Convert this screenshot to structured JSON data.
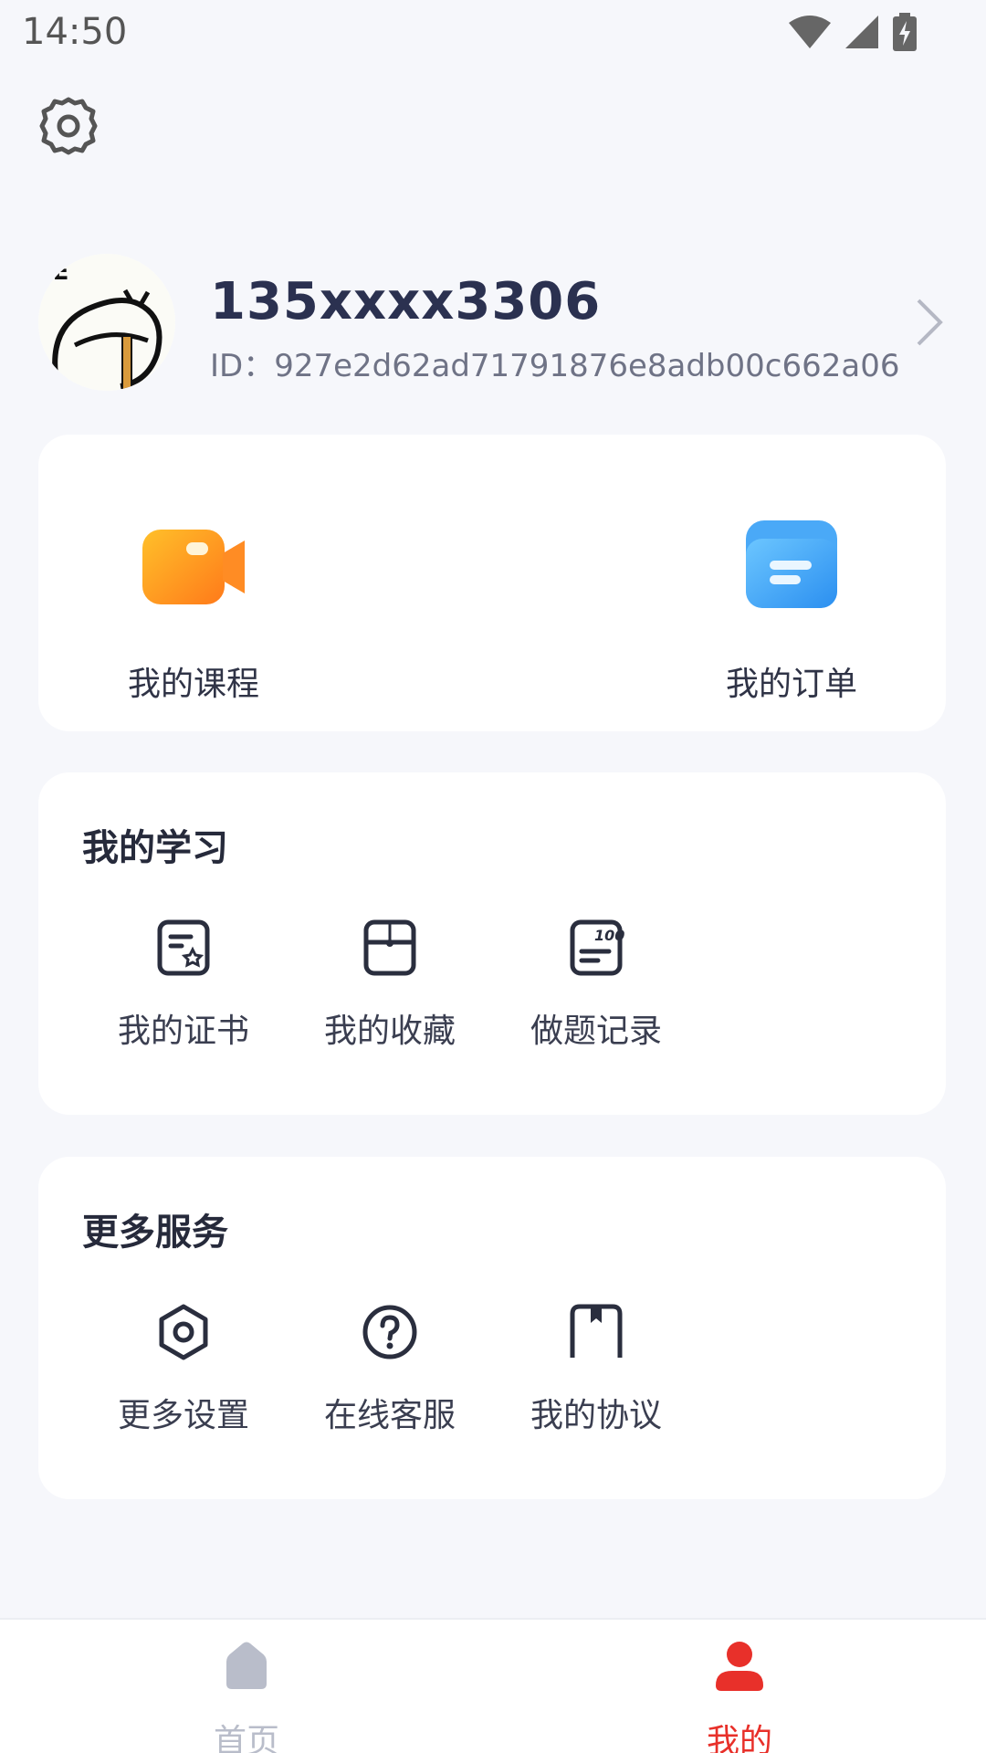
{
  "status_bar": {
    "time": "14:50"
  },
  "profile": {
    "username": "135xxxx3306",
    "id_text": "ID：927e2d62ad71791876e8adb00c662a06",
    "avatar_icon": "cat-avatar-icon"
  },
  "quick_actions": [
    {
      "label": "我的课程",
      "icon": "video-camera-icon",
      "color": "#ff9a1f"
    },
    {
      "label": "我的订单",
      "icon": "folder-icon",
      "color": "#3aa6f5"
    }
  ],
  "my_learning": {
    "title": "我的学习",
    "items": [
      {
        "label": "我的证书",
        "icon": "certificate-icon"
      },
      {
        "label": "我的收藏",
        "icon": "favorites-box-icon"
      },
      {
        "label": "做题记录",
        "icon": "exercise-record-icon"
      }
    ]
  },
  "more_services": {
    "title": "更多服务",
    "items": [
      {
        "label": "更多设置",
        "icon": "hexagon-settings-icon"
      },
      {
        "label": "在线客服",
        "icon": "question-circle-icon"
      },
      {
        "label": "我的协议",
        "icon": "agreement-book-icon"
      }
    ]
  },
  "bottom_nav": [
    {
      "label": "首页",
      "icon": "home-icon",
      "active": false,
      "color": "#b9bdca"
    },
    {
      "label": "我的",
      "icon": "user-icon",
      "active": true,
      "color": "#e8302a"
    }
  ]
}
